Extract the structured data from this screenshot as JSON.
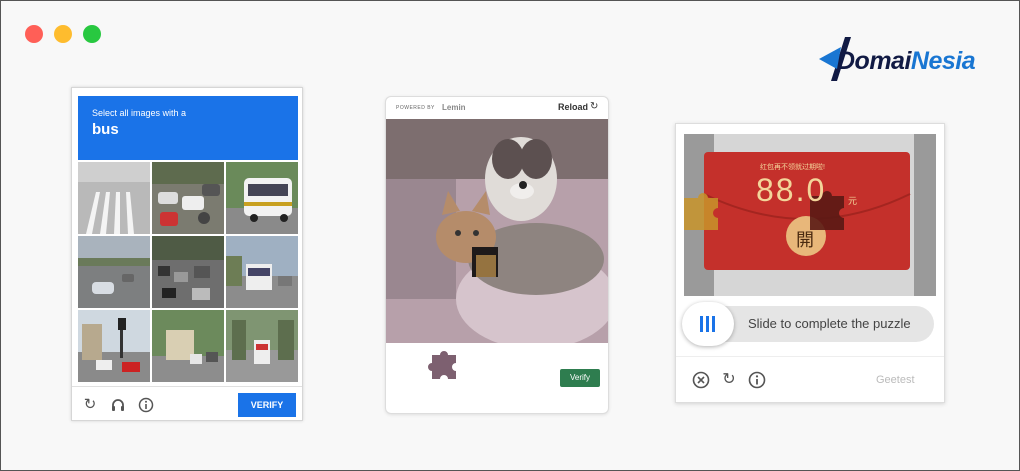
{
  "window": {
    "controls": [
      {
        "name": "close",
        "color": "#ff5f57"
      },
      {
        "name": "minimize",
        "color": "#febc2e"
      },
      {
        "name": "maximize",
        "color": "#28c840"
      }
    ]
  },
  "brand": {
    "logo_part1": "Domai",
    "logo_part2": "Nesia",
    "accent": "#1976d2",
    "dark": "#111a44"
  },
  "recaptcha": {
    "instruction": "Select all images with a",
    "target": "bus",
    "verify_label": "VERIFY",
    "icons": [
      "reload-icon",
      "audio-icon",
      "info-icon"
    ],
    "accent": "#1a73e8"
  },
  "lemin": {
    "powered_by": "POWERED BY",
    "brand": "Lemin",
    "reload_label": "Reload",
    "verify_label": "Verify",
    "accent": "#2e7d4f"
  },
  "geetest": {
    "banner_text": "红包再不领就过期啦!",
    "amount": "88.0",
    "currency": "元",
    "open_char": "開",
    "slider_label": "Slide to complete the puzzle",
    "brand": "Geetest",
    "icons": [
      "close-icon",
      "refresh-icon",
      "info-icon"
    ]
  }
}
